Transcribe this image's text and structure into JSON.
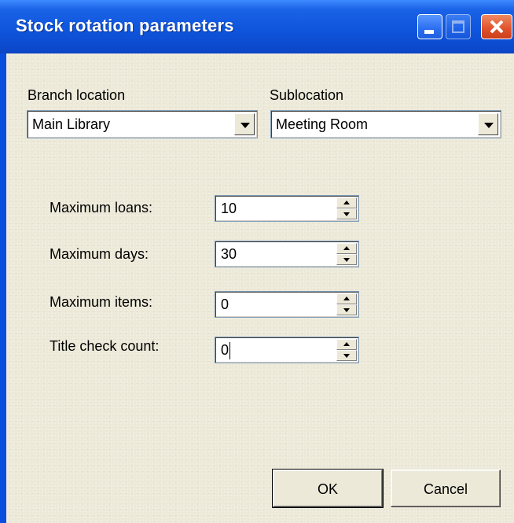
{
  "window": {
    "title": "Stock rotation parameters",
    "controls": {
      "minimize": "minimize-icon",
      "maximize": "maximize-icon",
      "close": "close-icon"
    }
  },
  "branch": {
    "label": "Branch location",
    "value": "Main Library"
  },
  "sublocation": {
    "label": "Sublocation",
    "value": "Meeting Room"
  },
  "fields": [
    {
      "label": "Maximum loans:",
      "value": "10"
    },
    {
      "label": "Maximum days:",
      "value": "30"
    },
    {
      "label": "Maximum items:",
      "value": "0"
    },
    {
      "label": "Title check count:",
      "value": "0"
    }
  ],
  "buttons": {
    "ok": "OK",
    "cancel": "Cancel"
  },
  "colors": {
    "titlebar": "#0c4bcf",
    "client_background": "#ece9d8",
    "close_button": "#e0502a"
  }
}
